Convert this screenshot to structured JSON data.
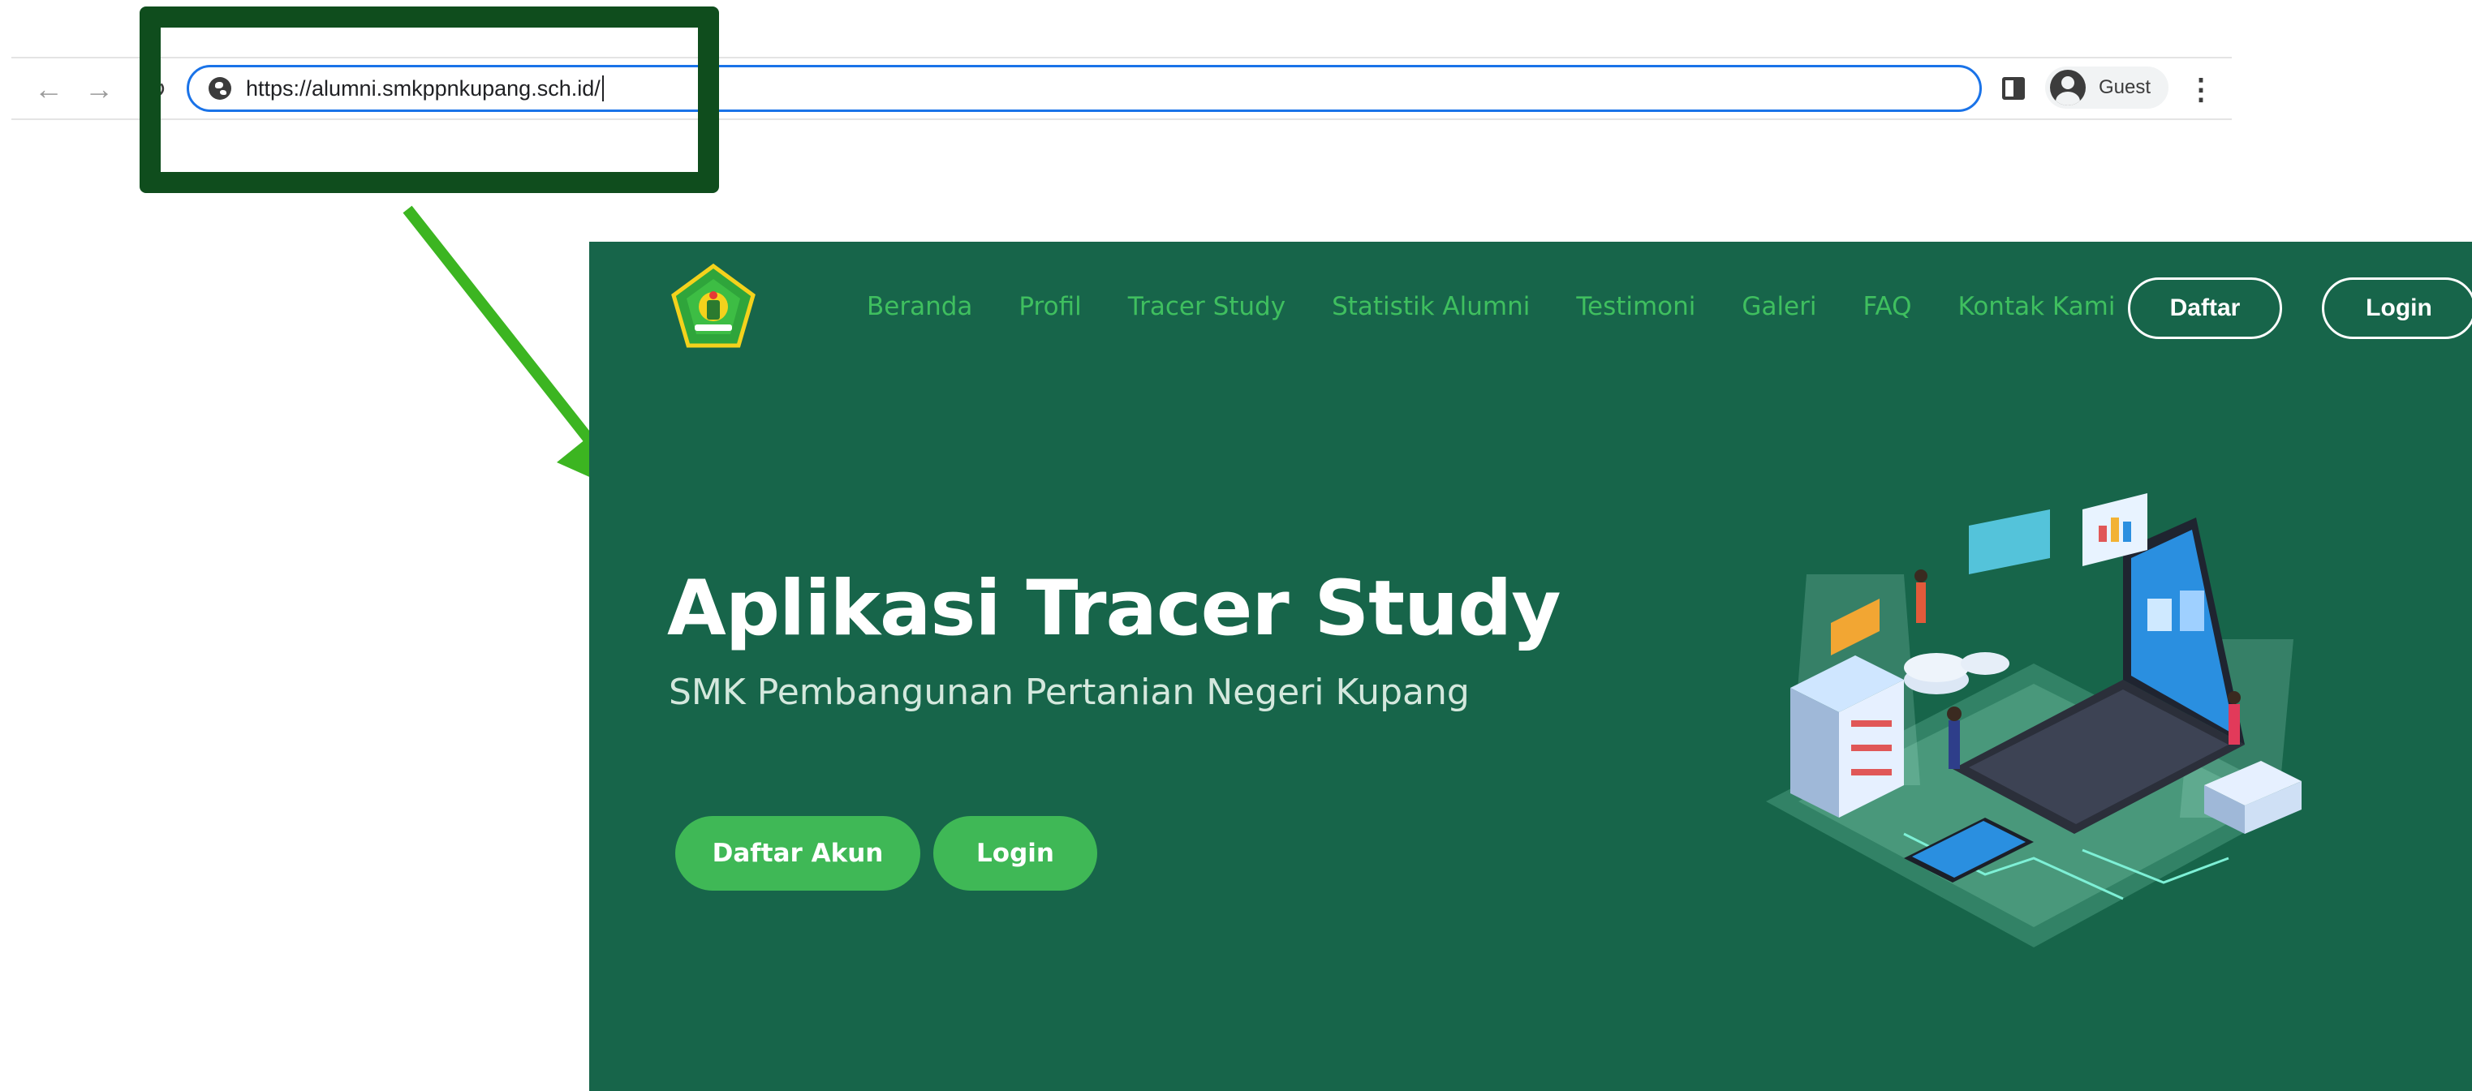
{
  "browser": {
    "url": "https://alumni.smkppnkupang.sch.id/",
    "profile_label": "Guest",
    "icons": [
      "back-arrow-icon",
      "forward-arrow-icon",
      "reload-icon",
      "globe-icon",
      "side-panel-icon",
      "avatar-icon",
      "more-menu-icon"
    ]
  },
  "annotation": {
    "highlight_color": "#0f4d1d",
    "arrow_color": "#3cb521"
  },
  "site": {
    "background": "#17654a",
    "nav": {
      "items": [
        "Beranda",
        "Profil",
        "Tracer Study",
        "Statistik Alumni",
        "Testimoni",
        "Galeri",
        "FAQ",
        "Kontak Kami"
      ],
      "daftar_label": "Daftar",
      "login_label": "Login"
    },
    "hero": {
      "title": "Aplikasi Tracer Study",
      "subtitle": "SMK Pembangunan Pertanian Negeri Kupang",
      "daftar_akun_label": "Daftar Akun",
      "login_label": "Login"
    },
    "accent": "#3fb856"
  }
}
